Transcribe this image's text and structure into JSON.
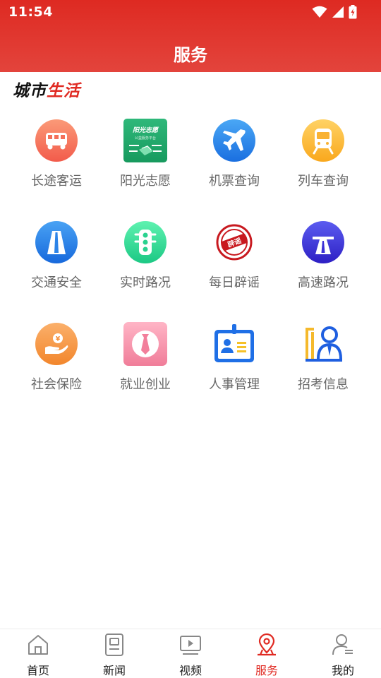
{
  "status": {
    "time": "11:54"
  },
  "header": {
    "title": "服务"
  },
  "brand": {
    "part1": "城市",
    "part2": "生活"
  },
  "services": [
    {
      "label": "长途客运",
      "icon": "bus-icon"
    },
    {
      "label": "阳光志愿",
      "icon": "sunshine-volunteer-icon",
      "badge_title": "阳光志愿",
      "badge_sub": "公益服务平台"
    },
    {
      "label": "机票查询",
      "icon": "airplane-icon"
    },
    {
      "label": "列车查询",
      "icon": "train-icon"
    },
    {
      "label": "交通安全",
      "icon": "road-icon"
    },
    {
      "label": "实时路况",
      "icon": "traffic-light-icon"
    },
    {
      "label": "每日辟谣",
      "icon": "rumor-stamp-icon",
      "stamp_text": "辟谣"
    },
    {
      "label": "高速路况",
      "icon": "highway-icon"
    },
    {
      "label": "社会保险",
      "icon": "insurance-hand-icon",
      "coin_text": "¥"
    },
    {
      "label": "就业创业",
      "icon": "employment-tie-icon"
    },
    {
      "label": "人事管理",
      "icon": "id-card-icon"
    },
    {
      "label": "招考信息",
      "icon": "exam-person-icon"
    }
  ],
  "nav": [
    {
      "label": "首页",
      "icon": "home-icon",
      "active": false
    },
    {
      "label": "新闻",
      "icon": "news-icon",
      "active": false
    },
    {
      "label": "视频",
      "icon": "video-icon",
      "active": false
    },
    {
      "label": "服务",
      "icon": "location-service-icon",
      "active": true
    },
    {
      "label": "我的",
      "icon": "profile-icon",
      "active": false
    }
  ],
  "colors": {
    "header_red": "#de2a22",
    "active_red": "#e02a22",
    "label_gray": "#666666"
  }
}
